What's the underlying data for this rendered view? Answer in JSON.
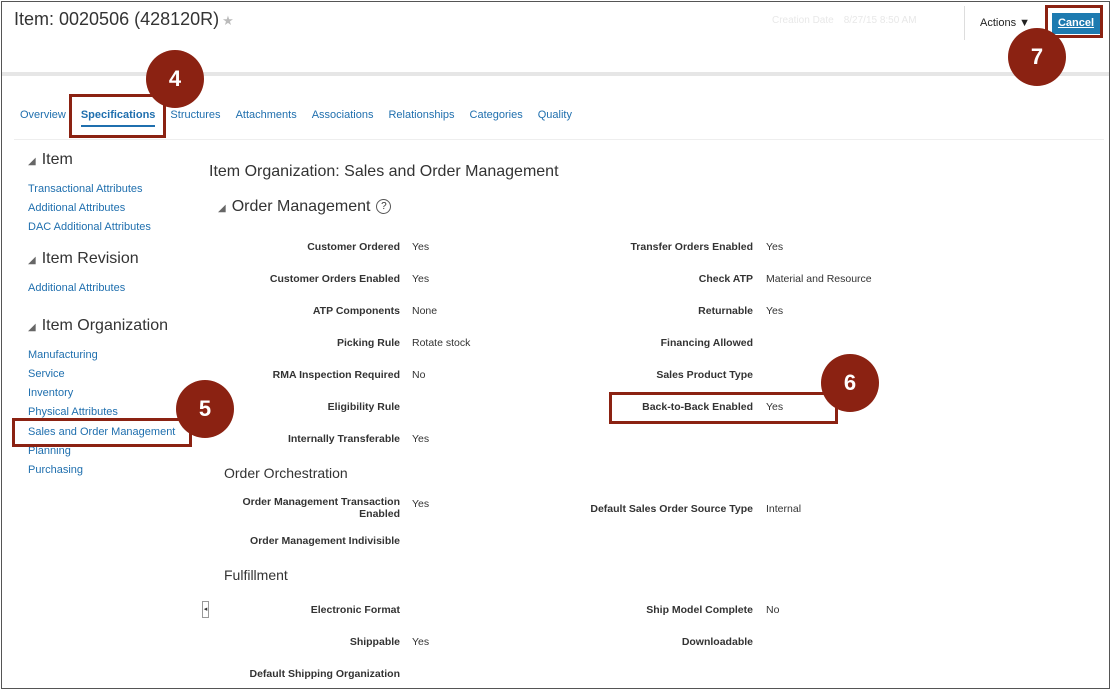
{
  "header": {
    "title": "Item: 0020506 (428120R)",
    "creation_date_label": "Creation Date",
    "creation_date_value": "8/27/15 8:50 AM",
    "actions_label": "Actions",
    "cancel_label": "Cancel"
  },
  "tabs": [
    "Overview",
    "Specifications",
    "Structures",
    "Attachments",
    "Associations",
    "Relationships",
    "Categories",
    "Quality"
  ],
  "sidebar": {
    "item": {
      "title": "Item",
      "links": [
        "Transactional Attributes",
        "Additional Attributes",
        "DAC Additional Attributes"
      ]
    },
    "revision": {
      "title": "Item Revision",
      "links": [
        "Additional Attributes"
      ]
    },
    "organization": {
      "title": "Item Organization",
      "links": [
        "Manufacturing",
        "Service",
        "Inventory",
        "Physical Attributes",
        "Sales and Order Management",
        "Planning",
        "Purchasing"
      ]
    }
  },
  "main": {
    "title": "Item Organization: Sales and Order Management",
    "order_management": {
      "title": "Order Management",
      "left": [
        {
          "label": "Customer Ordered",
          "value": "Yes"
        },
        {
          "label": "Customer Orders Enabled",
          "value": "Yes"
        },
        {
          "label": "ATP Components",
          "value": "None"
        },
        {
          "label": "Picking Rule",
          "value": "Rotate stock"
        },
        {
          "label": "RMA Inspection Required",
          "value": "No"
        },
        {
          "label": "Eligibility Rule",
          "value": ""
        },
        {
          "label": "Internally Transferable",
          "value": "Yes"
        }
      ],
      "right": [
        {
          "label": "Transfer Orders Enabled",
          "value": "Yes"
        },
        {
          "label": "Check ATP",
          "value": "Material and Resource"
        },
        {
          "label": "Returnable",
          "value": "Yes"
        },
        {
          "label": "Financing Allowed",
          "value": ""
        },
        {
          "label": "Sales Product Type",
          "value": ""
        },
        {
          "label": "Back-to-Back Enabled",
          "value": "Yes"
        }
      ]
    },
    "order_orchestration": {
      "title": "Order Orchestration",
      "left": [
        {
          "label": "Order Management Transaction Enabled",
          "value": "Yes"
        },
        {
          "label": "Order Management Indivisible",
          "value": ""
        }
      ],
      "right": [
        {
          "label": "Default Sales Order Source Type",
          "value": "Internal"
        }
      ]
    },
    "fulfillment": {
      "title": "Fulfillment",
      "left": [
        {
          "label": "Electronic Format",
          "value": ""
        },
        {
          "label": "Shippable",
          "value": "Yes"
        },
        {
          "label": "Default Shipping Organization",
          "value": ""
        }
      ],
      "right": [
        {
          "label": "Ship Model Complete",
          "value": "No"
        },
        {
          "label": "Downloadable",
          "value": ""
        }
      ]
    }
  },
  "callouts": [
    "4",
    "5",
    "6",
    "7"
  ]
}
